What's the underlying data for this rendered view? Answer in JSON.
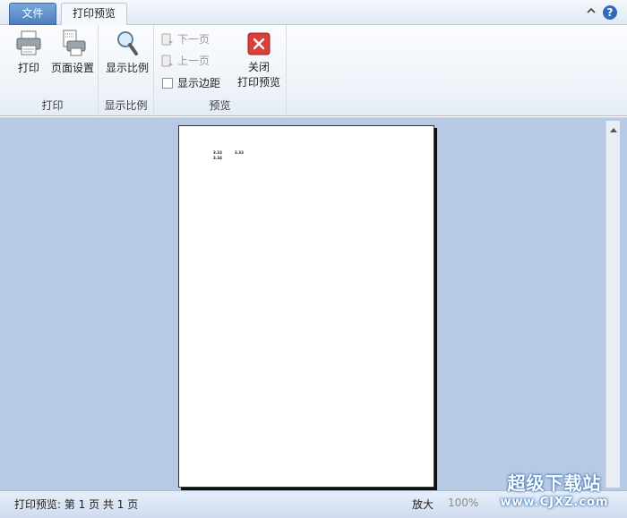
{
  "tabs": [
    {
      "label": "文件",
      "active": false
    },
    {
      "label": "打印预览",
      "active": true
    }
  ],
  "ribbon": {
    "print_group": {
      "label": "打印",
      "print_button": "打印",
      "page_setup_button": "页面设置"
    },
    "zoom_group": {
      "label": "显示比例",
      "zoom_button": "显示比例"
    },
    "preview_group": {
      "label": "预览",
      "next_page": "下一页",
      "prev_page": "上一页",
      "show_margins": "显示边距",
      "show_margins_checked": false,
      "close_button_line1": "关闭",
      "close_button_line2": "打印预览"
    }
  },
  "document": {
    "cells": [
      "3.33",
      "3.33",
      "3.34"
    ]
  },
  "status": {
    "page_info": "打印预览: 第 1 页 共 1 页",
    "zoom_in": "放大",
    "zoom_level": "100%"
  },
  "watermark": {
    "line1": "超级下载站",
    "line2": "www.CJXZ.com"
  },
  "colors": {
    "workspace": "#b8cae3",
    "ribbon": "#eef3f9",
    "file_tab": "#4d7fbf",
    "close_icon": "#d9403a"
  }
}
